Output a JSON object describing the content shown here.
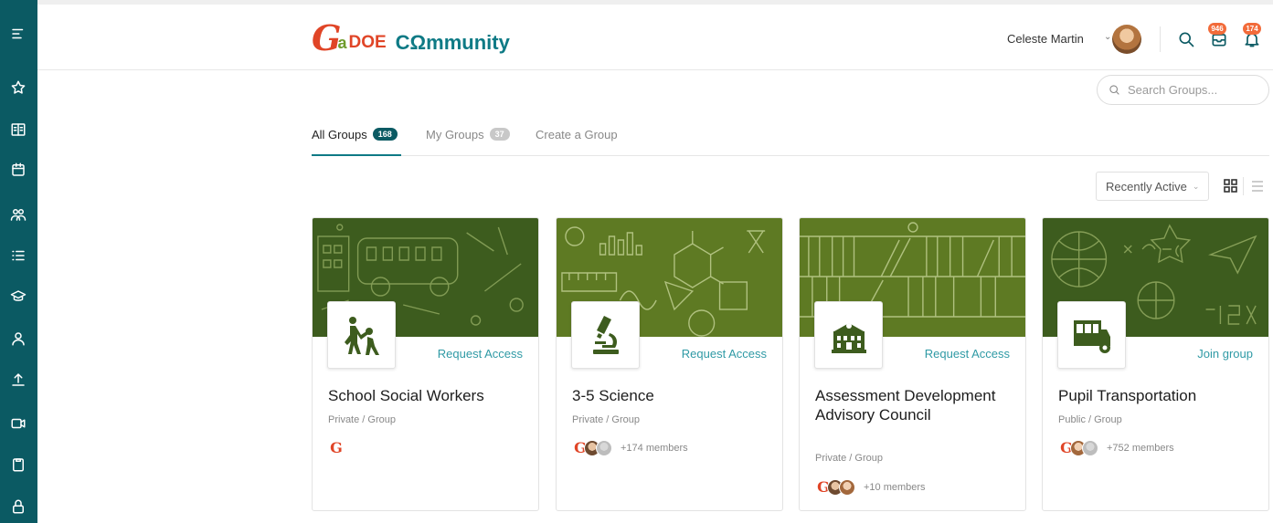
{
  "header": {
    "logo": {
      "g": "G",
      "a": "a",
      "doe": "DOE",
      "community": "CΩmmunity"
    },
    "user_name": "Celeste Martin",
    "messages_count": "946",
    "notifications_count": "174"
  },
  "search": {
    "placeholder": "Search Groups..."
  },
  "tabs": [
    {
      "label": "All Groups",
      "count": "168"
    },
    {
      "label": "My Groups",
      "count": "37"
    },
    {
      "label": "Create a Group"
    }
  ],
  "sort": {
    "label": "Recently Active"
  },
  "cards": [
    {
      "title": "School Social Workers",
      "action": "Request Access",
      "type": "Private / Group",
      "members": ""
    },
    {
      "title": "3-5 Science",
      "action": "Request Access",
      "type": "Private / Group",
      "members": "+174 members"
    },
    {
      "title": "Assessment Development Advisory Council",
      "action": "Request Access",
      "type": "Private / Group",
      "members": "+10 members"
    },
    {
      "title": "Pupil Transportation",
      "action": "Join group",
      "type": "Public / Group",
      "members": "+752 members"
    }
  ],
  "colors": {
    "sidebar": "#0b5a63",
    "accent": "#2f9aa5",
    "badge": "#f26b3a",
    "cover_dark": "#3d5c1e",
    "cover_olive": "#5e7a23"
  }
}
